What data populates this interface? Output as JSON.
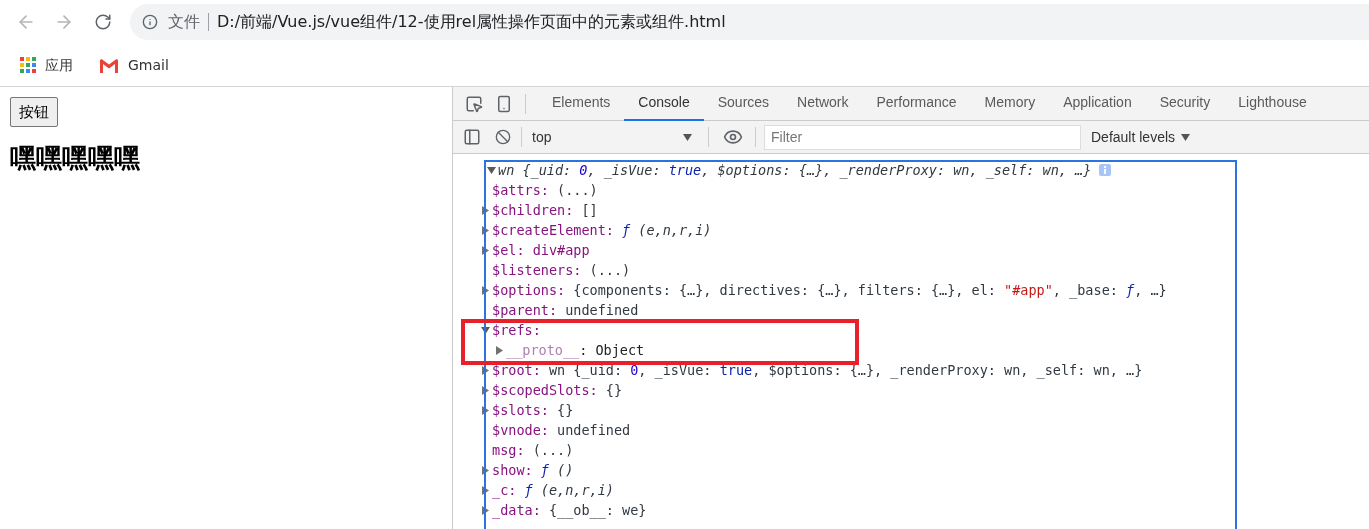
{
  "browser": {
    "address": {
      "scheme": "文件",
      "url": "D:/前端/Vue.js/vue组件/12-使用rel属性操作页面中的元素或组件.html"
    },
    "bookmarks": [
      {
        "kind": "apps",
        "label": "应用"
      },
      {
        "kind": "gmail",
        "label": "Gmail"
      }
    ]
  },
  "page": {
    "button": "按钮",
    "heading": "嘿嘿嘿嘿嘿"
  },
  "devtools": {
    "tabs": [
      {
        "label": "Elements",
        "selected": false
      },
      {
        "label": "Console",
        "selected": true
      },
      {
        "label": "Sources",
        "selected": false
      },
      {
        "label": "Network",
        "selected": false
      },
      {
        "label": "Performance",
        "selected": false
      },
      {
        "label": "Memory",
        "selected": false
      },
      {
        "label": "Application",
        "selected": false
      },
      {
        "label": "Security",
        "selected": false
      },
      {
        "label": "Lighthouse",
        "selected": false
      }
    ],
    "context": "top",
    "filter": {
      "placeholder": "Filter"
    },
    "levels": "Default levels",
    "console": {
      "object": {
        "expanded": true,
        "parts": [
          {
            "kind": "text",
            "text": "wn {_uid: "
          },
          {
            "kind": "num",
            "text": "0"
          },
          {
            "kind": "text",
            "text": ", _isVue: "
          },
          {
            "kind": "kw",
            "text": "true"
          },
          {
            "kind": "text",
            "text": ", $options: {…}, _renderProxy: wn, _self: wn, …}"
          }
        ],
        "children": [
          {
            "kind": "leaf",
            "key": "$attrs:",
            "dim": false,
            "parts": [
              {
                "kind": "text",
                "text": "(...)"
              }
            ]
          },
          {
            "kind": "node",
            "key": "$children:",
            "expanded": false,
            "dim": false,
            "parts": [
              {
                "kind": "text",
                "text": "[]"
              }
            ]
          },
          {
            "kind": "node",
            "key": "$createElement:",
            "expanded": false,
            "dim": false,
            "parts": [
              {
                "kind": "fn",
                "text": "ƒ"
              },
              {
                "kind": "args",
                "text": " (e,n,r,i)"
              }
            ]
          },
          {
            "kind": "node",
            "key": "$el:",
            "expanded": false,
            "dim": false,
            "parts": [
              {
                "kind": "node",
                "text": "div#app"
              }
            ]
          },
          {
            "kind": "leaf",
            "key": "$listeners:",
            "dim": false,
            "parts": [
              {
                "kind": "text",
                "text": "(...)"
              }
            ]
          },
          {
            "kind": "node",
            "key": "$options:",
            "expanded": false,
            "dim": false,
            "parts": [
              {
                "kind": "text",
                "text": "{components: {…}, directives: {…}, filters: {…}, el: "
              },
              {
                "kind": "str",
                "text": "\"#app\""
              },
              {
                "kind": "text",
                "text": ", _base: "
              },
              {
                "kind": "fn",
                "text": "ƒ"
              },
              {
                "kind": "text",
                "text": ", …}"
              }
            ]
          },
          {
            "kind": "leaf",
            "key": "$parent:",
            "dim": false,
            "parts": [
              {
                "kind": "text",
                "text": "undefined"
              }
            ]
          },
          {
            "kind": "node",
            "key": "$refs:",
            "expanded": true,
            "dim": false,
            "children": [
              {
                "kind": "node",
                "key": "__proto__",
                "expanded": false,
                "dim": true,
                "parts": [
                  {
                    "kind": "plain",
                    "text": ": Object"
                  }
                ]
              }
            ]
          },
          {
            "kind": "node",
            "key": "$root:",
            "expanded": false,
            "dim": false,
            "parts": [
              {
                "kind": "text",
                "text": "wn {_uid: "
              },
              {
                "kind": "num",
                "text": "0"
              },
              {
                "kind": "text",
                "text": ", _isVue: "
              },
              {
                "kind": "kw",
                "text": "true"
              },
              {
                "kind": "text",
                "text": ", $options: {…}, _renderProxy: wn, _self: wn, …}"
              }
            ]
          },
          {
            "kind": "node",
            "key": "$scopedSlots:",
            "expanded": false,
            "dim": false,
            "parts": [
              {
                "kind": "text",
                "text": "{}"
              }
            ]
          },
          {
            "kind": "node",
            "key": "$slots:",
            "expanded": false,
            "dim": false,
            "parts": [
              {
                "kind": "text",
                "text": "{}"
              }
            ]
          },
          {
            "kind": "leaf",
            "key": "$vnode:",
            "dim": false,
            "parts": [
              {
                "kind": "text",
                "text": "undefined"
              }
            ]
          },
          {
            "kind": "leaf",
            "key": "msg:",
            "dim": false,
            "parts": [
              {
                "kind": "text",
                "text": "(...)"
              }
            ]
          },
          {
            "kind": "node",
            "key": "show:",
            "expanded": false,
            "dim": false,
            "parts": [
              {
                "kind": "fn",
                "text": "ƒ"
              },
              {
                "kind": "args",
                "text": " ()"
              }
            ]
          },
          {
            "kind": "node",
            "key": "_c:",
            "expanded": false,
            "dim": false,
            "parts": [
              {
                "kind": "fn",
                "text": "ƒ"
              },
              {
                "kind": "args",
                "text": " (e,n,r,i)"
              }
            ]
          },
          {
            "kind": "node",
            "key": "_data:",
            "expanded": false,
            "dim": false,
            "parts": [
              {
                "kind": "text",
                "text": "{__ob__: we}"
              }
            ]
          }
        ]
      }
    }
  }
}
